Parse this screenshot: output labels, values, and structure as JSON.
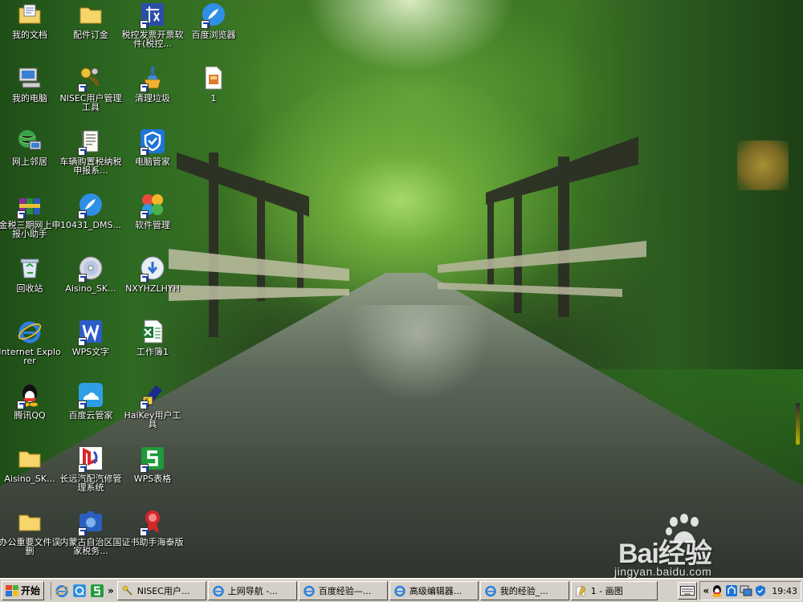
{
  "desktop": {
    "icons": [
      {
        "label": "我的文档",
        "icon": "my-documents-icon"
      },
      {
        "label": "配件订金",
        "icon": "folder-icon"
      },
      {
        "label": "税控发票开票软件(税控...",
        "icon": "tax-invoice-icon"
      },
      {
        "label": "百度浏览器",
        "icon": "baidu-browser-icon"
      },
      {
        "label": "我的电脑",
        "icon": "my-computer-icon"
      },
      {
        "label": "NISEC用户管理工具",
        "icon": "keys-icon"
      },
      {
        "label": "清理垃圾",
        "icon": "broom-icon"
      },
      {
        "label": "1",
        "icon": "paint-file-icon"
      },
      {
        "label": "网上邻居",
        "icon": "network-icon"
      },
      {
        "label": "车辆购置税纳税申报系...",
        "icon": "document-icon"
      },
      {
        "label": "电脑管家",
        "icon": "shield-icon"
      },
      {
        "label": "金税三期网上申报小助手",
        "icon": "winrar-icon"
      },
      {
        "label": "10431_DMS...",
        "icon": "compass-icon"
      },
      {
        "label": "软件管理",
        "icon": "software-manager-icon"
      },
      {
        "label": "回收站",
        "icon": "recycle-bin-icon"
      },
      {
        "label": "Aisino_SK...",
        "icon": "cd-icon"
      },
      {
        "label": "NXYHZLHYH",
        "icon": "installer-icon"
      },
      {
        "label": "Internet Explorer",
        "icon": "ie-icon"
      },
      {
        "label": "WPS文字",
        "icon": "wps-writer-icon"
      },
      {
        "label": "工作簿1",
        "icon": "excel-icon"
      },
      {
        "label": "腾讯QQ",
        "icon": "qq-icon"
      },
      {
        "label": "百度云管家",
        "icon": "baidu-cloud-icon"
      },
      {
        "label": "HaiKey用户工具",
        "icon": "haikey-icon"
      },
      {
        "label": "Aisino_SK...",
        "icon": "folder-icon"
      },
      {
        "label": "长远汽配汽修管理系统",
        "icon": "auto-parts-icon"
      },
      {
        "label": "WPS表格",
        "icon": "wps-sheet-icon"
      },
      {
        "label": "办公重要文件误删",
        "icon": "folder-icon"
      },
      {
        "label": "内蒙古自治区国家税务...",
        "icon": "tax-bureau-icon"
      },
      {
        "label": "证书助手海泰版",
        "icon": "certificate-icon"
      }
    ]
  },
  "taskbar": {
    "start_label": "开始",
    "more": "»",
    "quick_launch": [
      "ie-icon",
      "qq-browser-icon",
      "wps-sheet-icon"
    ],
    "tasks": [
      {
        "label": "NISEC用户...",
        "icon": "keys-icon"
      },
      {
        "label": "上网导航 -...",
        "icon": "ie-icon"
      },
      {
        "label": "百度经验—...",
        "icon": "ie-icon"
      },
      {
        "label": "高级编辑器...",
        "icon": "ie-icon"
      },
      {
        "label": "我的经验_...",
        "icon": "ie-icon"
      },
      {
        "label": "1 - 画图",
        "icon": "paint-icon"
      }
    ],
    "tray": {
      "chevron": "«",
      "icons": [
        "keyboard-icon",
        "qq-tray-icon",
        "network-tray-icon",
        "monitor-tray-icon",
        "shield-tray-icon"
      ],
      "clock": "19:43"
    }
  },
  "watermark": {
    "brand": "Bai经验",
    "sub": "jingyan.baidu.com"
  }
}
